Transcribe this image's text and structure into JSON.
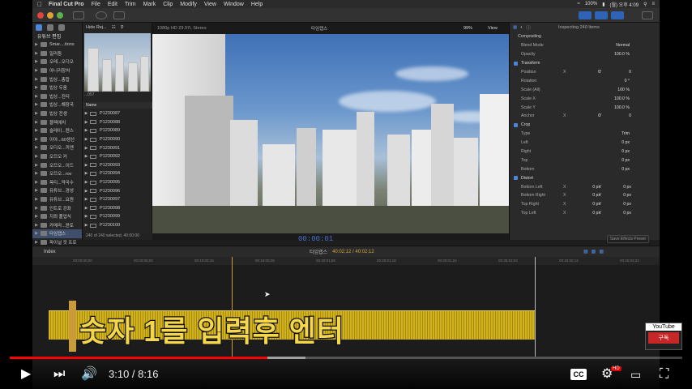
{
  "menubar": {
    "app": "Final Cut Pro",
    "items": [
      "File",
      "Edit",
      "Trim",
      "Mark",
      "Clip",
      "Modify",
      "View",
      "Window",
      "Help"
    ],
    "battery": "100%",
    "clock": "(월) 오후 4:09"
  },
  "library": {
    "root": "유튜브 편집",
    "items": [
      "Smar....tions",
      "일러둠",
      "오레...오디오",
      "아니러창처",
      "빕상...총합",
      "빕상 두움",
      "빕상...진터",
      "빕상...해장국",
      "빕상 전생",
      "블렉에치",
      "슬레이...렌스",
      "이야...60생선",
      "오디오...끼엔",
      "오므오 커",
      "오므오...이드",
      "오므오...rov",
      "옥티...약국수",
      "유튜브...경성",
      "유튜브...요원",
      "인트로 강좌",
      "지뢰 풀업식",
      "카메라...윤토",
      "타임랩스",
      "파이널 컷 프로"
    ],
    "selected": "타임랩스"
  },
  "browser": {
    "filter": "Hide Rej...",
    "thumb_caption": "...057",
    "list_header": "Name",
    "clips": [
      "P1230087",
      "P1230088",
      "P1230089",
      "P1230090",
      "P1230091",
      "P1230092",
      "P1230093",
      "P1230094",
      "P1230095",
      "P1230096",
      "P1230097",
      "P1230098",
      "P1230099",
      "P1230100"
    ],
    "footer": "240 of 240 selected, 40:00:00"
  },
  "viewer": {
    "format": "1080p HD 29.97i, Stereo",
    "title": "타임랩스",
    "zoom": "99%",
    "view_menu": "View",
    "timecode": "00:00:01"
  },
  "inspector": {
    "header": "Inspecting 240 Items",
    "compositing": {
      "title": "Compositing",
      "blend_label": "Blend Mode",
      "blend_value": "Normal",
      "opacity_label": "Opacity",
      "opacity_value": "100.0 %"
    },
    "transform": {
      "title": "Transform",
      "position_label": "Position",
      "position_x": "0",
      "position_y": "0",
      "rotation_label": "Rotation",
      "rotation_value": "0 °",
      "scale_all_label": "Scale (All)",
      "scale_all": "100 %",
      "scale_x_label": "Scale X",
      "scale_x": "100.0 %",
      "scale_y_label": "Scale Y",
      "scale_y": "100.0 %",
      "anchor_label": "Anchor",
      "anchor_x": "0",
      "anchor_y": "0"
    },
    "crop": {
      "title": "Crop",
      "type_label": "Type",
      "type_value": "Trim",
      "left_label": "Left",
      "left": "0 px",
      "right_label": "Right",
      "right": "0 px",
      "top_label": "Top",
      "top": "0 px",
      "bottom_label": "Bottom",
      "bottom": "0 px"
    },
    "distort": {
      "title": "Distort",
      "bl_label": "Bottom Left",
      "bl_x": "0 px",
      "bl_y": "0 px",
      "br_label": "Bottom Right",
      "br_x": "0 px",
      "br_y": "0 px",
      "tr_label": "Top Right",
      "tr_x": "0 px",
      "tr_y": "0 px",
      "tl_label": "Top Left",
      "tl_x": "0 px",
      "tl_y": "0 px"
    },
    "save_preset": "Save Effects Preset"
  },
  "timeline": {
    "index_label": "Index",
    "project": "타임랩스",
    "duration": "40:02;12 / 40:02;12",
    "ruler": [
      "00:00:00;00",
      "00:00:05;00",
      "00:10:00;16",
      "00:15:00;28",
      "00:20:01;08",
      "00:25:01;18",
      "00:30:01;24",
      "00:35:02;04",
      "00:40:02;12",
      "00:45:02;24"
    ]
  },
  "caption": "숫자 1를 입력후 엔터",
  "youtube_badge": {
    "top": "YouTube",
    "bottom": "구독"
  },
  "player": {
    "current": "3:10",
    "duration": "8:16",
    "separator": " / ",
    "played_fraction": 0.383,
    "buffered_fraction": 0.44,
    "accent": "#ff0000"
  }
}
